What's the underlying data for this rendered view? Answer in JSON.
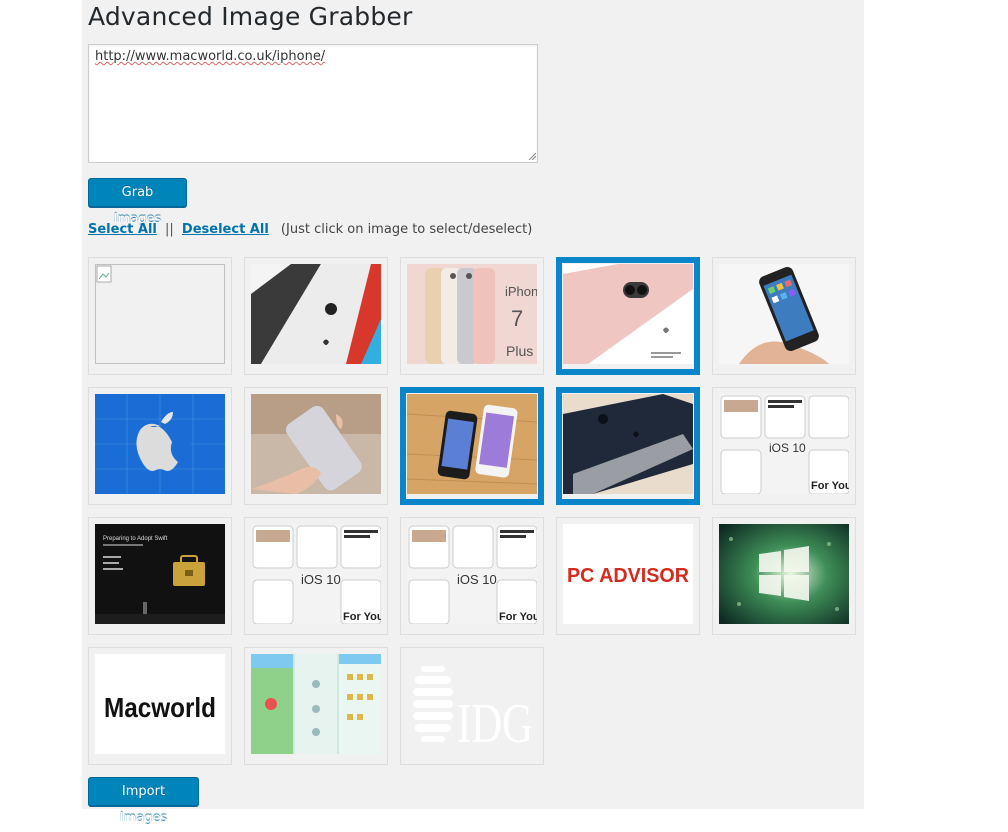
{
  "page": {
    "title": "Advanced Image Grabber"
  },
  "url_input": {
    "value": "http://www.macworld.co.uk/iphone/"
  },
  "buttons": {
    "grab_label": "Grab Images",
    "import_label": "Import Images"
  },
  "selection": {
    "select_all": "Select All",
    "separator": "||",
    "deselect_all": "Deselect All",
    "hint": "(Just click on image to select/deselect)"
  },
  "images": [
    {
      "name": "broken-image",
      "selected": false
    },
    {
      "name": "iphone-cases-red-blue",
      "selected": false
    },
    {
      "name": "iphone-7-plus-colors",
      "selected": false,
      "caption_lines": [
        "iPhone",
        "7",
        "Plus"
      ]
    },
    {
      "name": "iphone-7-plus-rose-gold",
      "selected": true
    },
    {
      "name": "iphone-in-hand",
      "selected": false
    },
    {
      "name": "apple-logo-blue",
      "selected": false
    },
    {
      "name": "hand-holding-iphone",
      "selected": false
    },
    {
      "name": "two-iphones-on-wood",
      "selected": true
    },
    {
      "name": "iphone-7-jet-black",
      "selected": true
    },
    {
      "name": "ios-10-screens",
      "selected": false,
      "caption_lines": [
        "iOS 10",
        "For You"
      ]
    },
    {
      "name": "swift-presentation-stage",
      "selected": false,
      "caption_lines": [
        "Preparing to Adopt Swift"
      ]
    },
    {
      "name": "ios-10-screens-2",
      "selected": false,
      "caption_lines": [
        "iOS 10",
        "For You"
      ]
    },
    {
      "name": "ios-10-screens-3",
      "selected": false,
      "caption_lines": [
        "iOS 10",
        "For You"
      ]
    },
    {
      "name": "pc-advisor-logo",
      "selected": false,
      "caption_lines": [
        "PC ADVISOR"
      ]
    },
    {
      "name": "windows-logo-rain",
      "selected": false
    },
    {
      "name": "macworld-logo",
      "selected": false,
      "caption_lines": [
        "Macworld"
      ]
    },
    {
      "name": "pokemon-go-screens",
      "selected": false
    },
    {
      "name": "idg-logo",
      "selected": false,
      "caption_lines": [
        "IDG"
      ]
    }
  ]
}
